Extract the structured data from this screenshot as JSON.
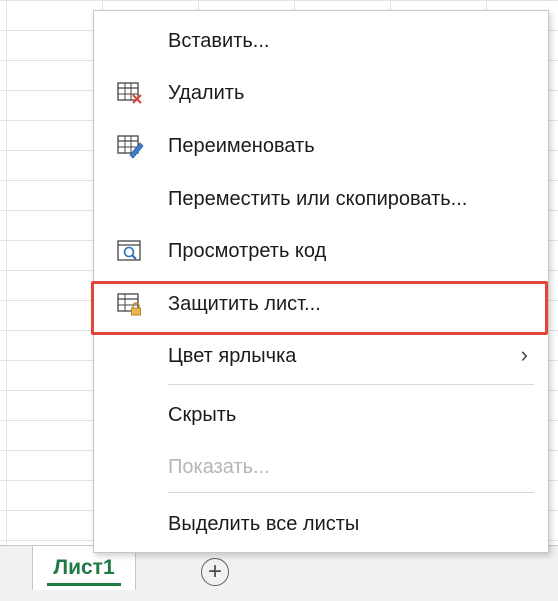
{
  "menu": {
    "items": [
      {
        "label": "Вставить...",
        "icon": null,
        "disabled": false
      },
      {
        "label": "Удалить",
        "icon": "delete-sheet-icon",
        "disabled": false
      },
      {
        "label": "Переименовать",
        "icon": "rename-sheet-icon",
        "disabled": false
      },
      {
        "label": "Переместить или скопировать...",
        "icon": null,
        "disabled": false
      },
      {
        "label": "Просмотреть код",
        "icon": "view-code-icon",
        "disabled": false
      },
      {
        "label": "Защитить лист...",
        "icon": "protect-sheet-icon",
        "disabled": false,
        "highlighted": true
      },
      {
        "label": "Цвет ярлычка",
        "icon": null,
        "disabled": false,
        "submenu": true
      },
      {
        "label": "Скрыть",
        "icon": null,
        "disabled": false
      },
      {
        "label": "Показать...",
        "icon": null,
        "disabled": true
      },
      {
        "label": "Выделить все листы",
        "icon": null,
        "disabled": false
      }
    ]
  },
  "sheet_tabs": [
    {
      "label": "Лист1",
      "active": true
    }
  ],
  "add_sheet_symbol": "+",
  "colors": {
    "highlight": "#e0473a",
    "tab_green": "#1f7a43"
  }
}
